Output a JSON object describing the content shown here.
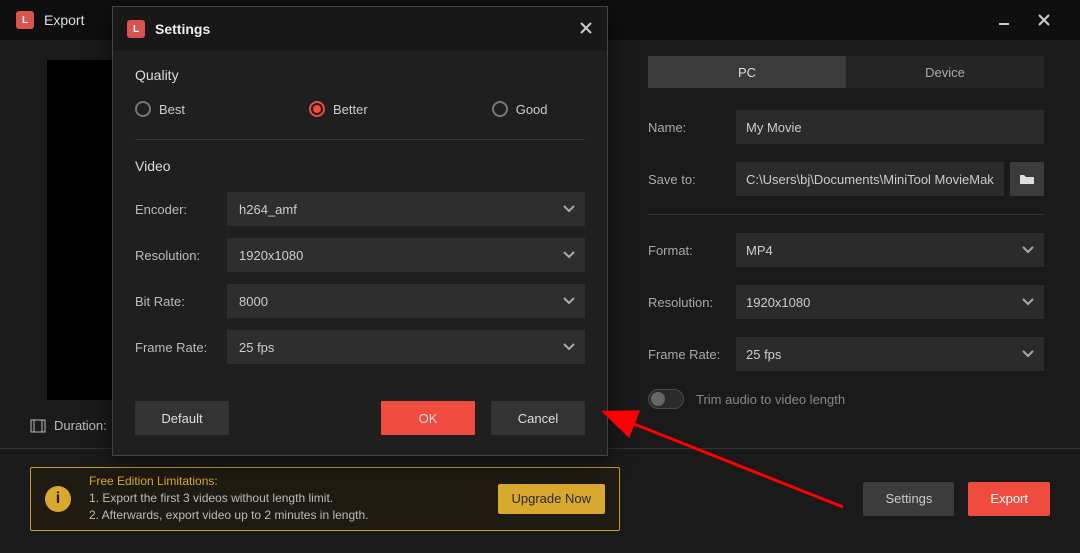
{
  "titlebar": {
    "title": "Export"
  },
  "preview": {
    "duration_label": "Duration:"
  },
  "tabs": {
    "pc": "PC",
    "device": "Device"
  },
  "fields": {
    "name_label": "Name:",
    "name_value": "My Movie",
    "saveto_label": "Save to:",
    "saveto_value": "C:\\Users\\bj\\Documents\\MiniTool MovieMaker\\outp",
    "format_label": "Format:",
    "format_value": "MP4",
    "resolution_label": "Resolution:",
    "resolution_value": "1920x1080",
    "framerate_label": "Frame Rate:",
    "framerate_value": "25 fps",
    "trim_label": "Trim audio to video length"
  },
  "footer": {
    "limit_title": "Free Edition Limitations:",
    "limit_1": "1. Export the first 3 videos without length limit.",
    "limit_2": "2. Afterwards, export video up to 2 minutes in length.",
    "upgrade": "Upgrade Now",
    "settings": "Settings",
    "export": "Export"
  },
  "modal": {
    "title": "Settings",
    "quality_title": "Quality",
    "q_best": "Best",
    "q_better": "Better",
    "q_good": "Good",
    "video_title": "Video",
    "encoder_label": "Encoder:",
    "encoder_value": "h264_amf",
    "resolution_label": "Resolution:",
    "resolution_value": "1920x1080",
    "bitrate_label": "Bit Rate:",
    "bitrate_value": "8000",
    "framerate_label": "Frame Rate:",
    "framerate_value": "25 fps",
    "default_btn": "Default",
    "ok_btn": "OK",
    "cancel_btn": "Cancel"
  }
}
